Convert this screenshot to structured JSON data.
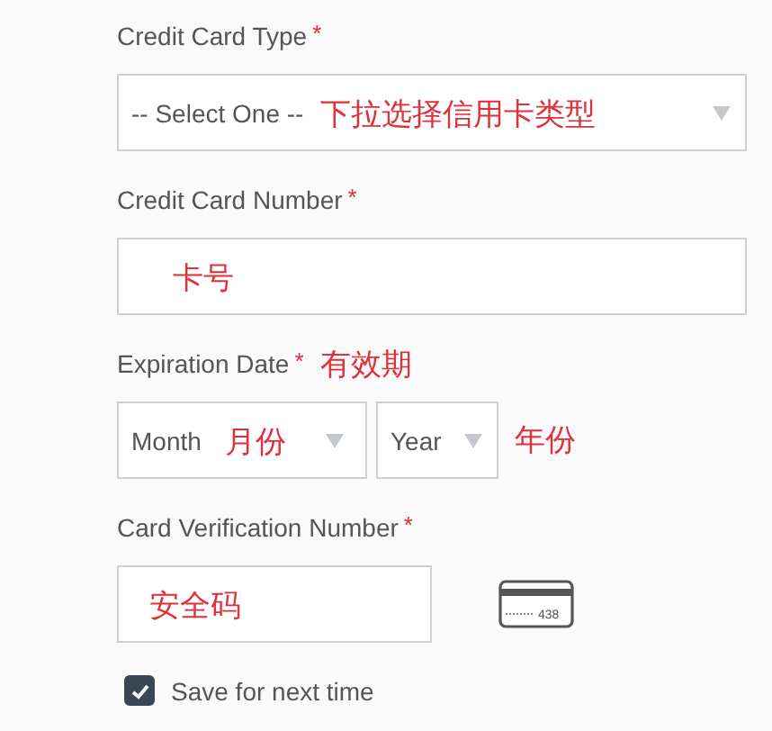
{
  "fields": [
    {
      "kind": "select",
      "label": "Credit Card Type",
      "required_mark": "*",
      "placeholder": "-- Select One --",
      "note": "下拉选择信用卡类型"
    },
    {
      "kind": "text",
      "label": "Credit Card Number",
      "required_mark": "*",
      "note": "卡号"
    },
    {
      "kind": "date",
      "label": "Expiration Date",
      "required_mark": "*",
      "label_note": "有效期",
      "selects": [
        {
          "placeholder": "Month",
          "note": "月份"
        },
        {
          "placeholder": "Year"
        }
      ],
      "note": "年份"
    },
    {
      "kind": "cvv",
      "label": "Card Verification Number",
      "required_mark": "*",
      "note": "安全码",
      "card_icon_text": "438"
    }
  ],
  "save": {
    "label": "Save for next time",
    "checked": true
  }
}
